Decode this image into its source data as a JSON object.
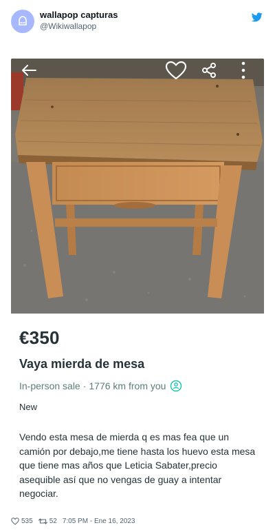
{
  "tweet": {
    "display_name": "wallapop capturas",
    "handle": "@Wikiwallapop",
    "likes": "535",
    "retweets": "52",
    "timestamp": "7:05 PM - Ene 16, 2023"
  },
  "listing": {
    "price": "€350",
    "title": "Vaya mierda de mesa",
    "delivery_type": "In-person sale",
    "separator": "·",
    "distance": "1776 km from you",
    "condition": "New",
    "description": "Vendo esta mesa de mierda q es mas fea que un camión por debajo,me tiene hasta los huevo esta mesa que tiene mas años que  Leticia Sabater,precio asequible así que no vengas de guay a intentar negociar."
  },
  "colors": {
    "twitter_blue": "#1d9bf0",
    "avatar_bg": "#a7b8ff",
    "wallapop_teal": "#13c1ac",
    "delivery_text": "#5a7d7a",
    "text_dark": "#253238"
  },
  "icons": {
    "back": "arrow-left-icon",
    "favorite": "heart-icon",
    "share": "share-icon",
    "more": "more-vertical-icon",
    "location": "user-pin-icon",
    "twitter": "twitter-bird-icon"
  }
}
